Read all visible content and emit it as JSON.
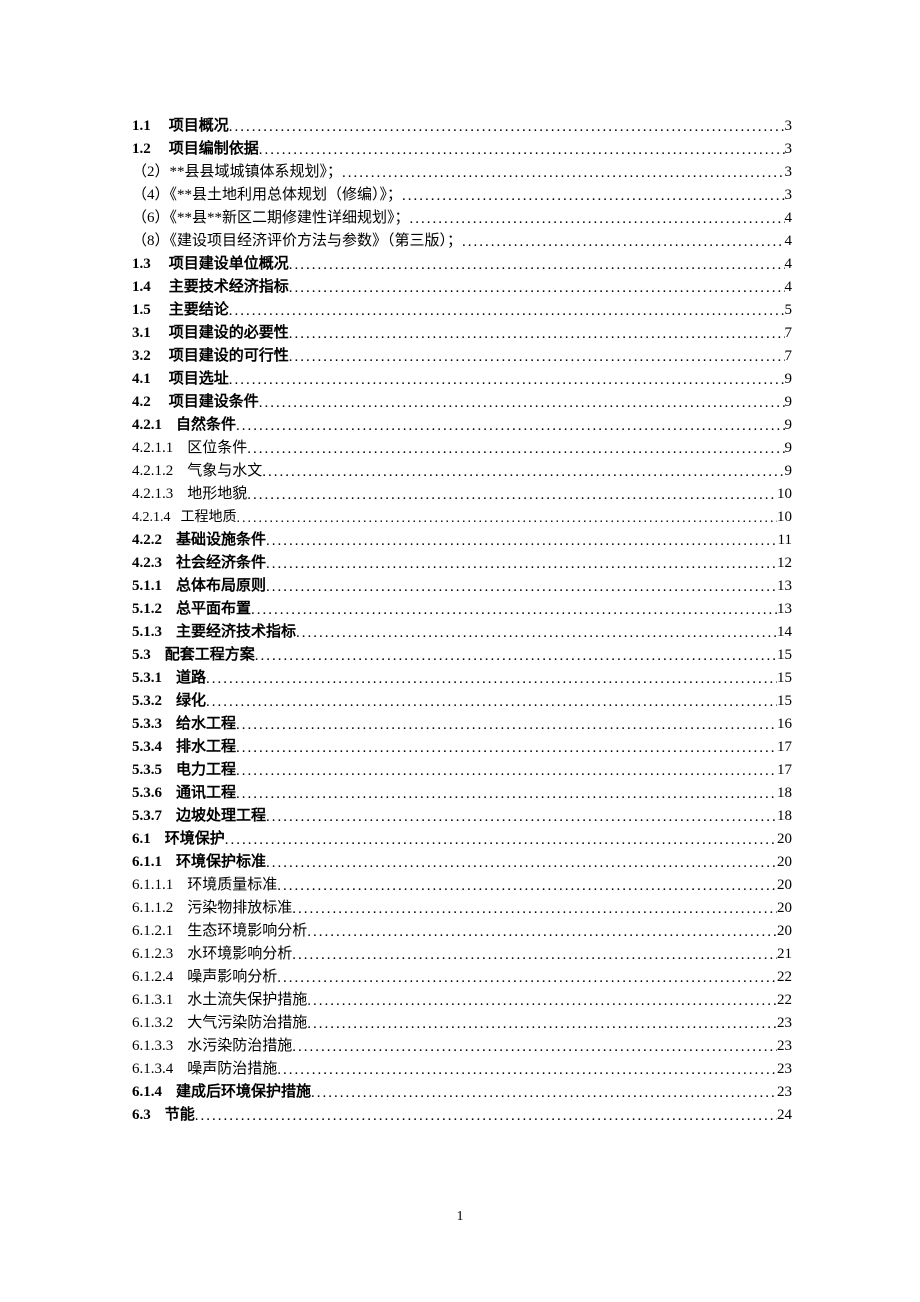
{
  "footer_page": "1",
  "entries": [
    {
      "bold": true,
      "num": "1.1",
      "numGap": "gap-small",
      "title": "项目概况",
      "page": "3"
    },
    {
      "bold": true,
      "num": "1.2",
      "numGap": "gap-small",
      "title": "项目编制依据",
      "page": "3"
    },
    {
      "bold": false,
      "num": "",
      "numGap": "",
      "title": "（2）**县县域城镇体系规划》；",
      "page": "3"
    },
    {
      "bold": false,
      "num": "",
      "numGap": "",
      "title": "（4）《**县土地利用总体规划（修编）》；",
      "page": "3"
    },
    {
      "bold": false,
      "num": "",
      "numGap": "",
      "title": "（6）《**县**新区二期修建性详细规划》；",
      "page": "4"
    },
    {
      "bold": false,
      "num": "",
      "numGap": "",
      "title": "（8）《建设项目经济评价方法与参数》（第三版）；",
      "page": "4"
    },
    {
      "bold": true,
      "num": "1.3",
      "numGap": "gap-small",
      "title": "项目建设单位概况",
      "page": "4"
    },
    {
      "bold": true,
      "num": "1.4",
      "numGap": "gap-small",
      "title": "主要技术经济指标",
      "page": "4"
    },
    {
      "bold": true,
      "num": "1.5",
      "numGap": "gap-small",
      "title": "主要结论",
      "page": "5"
    },
    {
      "bold": true,
      "num": "3.1",
      "numGap": "gap-small",
      "title": "项目建设的必要性",
      "page": "7"
    },
    {
      "bold": true,
      "num": "3.2",
      "numGap": "gap-small",
      "title": "项目建设的可行性",
      "page": "7"
    },
    {
      "bold": true,
      "num": "4.1",
      "numGap": "gap-small",
      "title": "项目选址",
      "page": "9"
    },
    {
      "bold": true,
      "num": "4.2",
      "numGap": "gap-small",
      "title": "项目建设条件",
      "page": "9"
    },
    {
      "bold": true,
      "num": "4.2.1",
      "numGap": "gap-med",
      "title": "自然条件",
      "page": "9"
    },
    {
      "bold": false,
      "num": "4.2.1.1",
      "numGap": "gap-med",
      "title": "区位条件",
      "page": "9"
    },
    {
      "bold": false,
      "num": "4.2.1.2",
      "numGap": "gap-med",
      "title": "气象与水文",
      "page": "9"
    },
    {
      "bold": false,
      "num": "4.2.1.3",
      "numGap": "gap-med",
      "title": "地形地貌",
      "page": "10"
    },
    {
      "bold": false,
      "sans": true,
      "num": "4.2.1.4",
      "numGap": "gap-tight",
      "title": "工程地质",
      "page": "10"
    },
    {
      "bold": true,
      "num": "4.2.2",
      "numGap": "gap-med",
      "title": "基础设施条件",
      "page": "11"
    },
    {
      "bold": true,
      "num": "4.2.3",
      "numGap": "gap-med",
      "title": "社会经济条件",
      "page": "12"
    },
    {
      "bold": true,
      "num": "5.1.1",
      "numGap": "gap-med",
      "title": "总体布局原则",
      "page": "13"
    },
    {
      "bold": true,
      "num": "5.1.2",
      "numGap": "gap-med",
      "title": "总平面布置",
      "page": "13"
    },
    {
      "bold": true,
      "num": "5.1.3",
      "numGap": "gap-med",
      "title": "主要经济技术指标",
      "page": "14"
    },
    {
      "bold": true,
      "num": "5.3",
      "numGap": "gap-med",
      "title": "配套工程方案",
      "page": "15"
    },
    {
      "bold": true,
      "num": "5.3.1",
      "numGap": "gap-med",
      "title": "道路",
      "page": "15"
    },
    {
      "bold": true,
      "num": "5.3.2",
      "numGap": "gap-med",
      "title": "绿化",
      "page": "15"
    },
    {
      "bold": true,
      "num": "5.3.3",
      "numGap": "gap-med",
      "title": "给水工程",
      "page": "16"
    },
    {
      "bold": true,
      "num": "5.3.4",
      "numGap": "gap-med",
      "title": "排水工程",
      "page": "17"
    },
    {
      "bold": true,
      "num": "5.3.5",
      "numGap": "gap-med",
      "title": "电力工程",
      "page": "17"
    },
    {
      "bold": true,
      "num": "5.3.6",
      "numGap": "gap-med",
      "title": "通讯工程",
      "page": "18"
    },
    {
      "bold": true,
      "num": "5.3.7",
      "numGap": "gap-med",
      "title": "边坡处理工程",
      "page": "18"
    },
    {
      "bold": true,
      "num": "6.1",
      "numGap": "gap-med",
      "title": "环境保护",
      "page": "20"
    },
    {
      "bold": true,
      "num": "6.1.1",
      "numGap": "gap-med",
      "title": "环境保护标准",
      "page": "20"
    },
    {
      "bold": false,
      "num": "6.1.1.1",
      "numGap": "gap-med",
      "title": "环境质量标准",
      "page": "20"
    },
    {
      "bold": false,
      "num": "6.1.1.2",
      "numGap": "gap-med",
      "title": "污染物排放标准",
      "page": "20"
    },
    {
      "bold": false,
      "num": "6.1.2.1",
      "numGap": "gap-med",
      "title": "生态环境影响分析",
      "page": "20"
    },
    {
      "bold": false,
      "num": "6.1.2.3",
      "numGap": "gap-med",
      "title": "水环境影响分析",
      "page": "21"
    },
    {
      "bold": false,
      "num": "6.1.2.4",
      "numGap": "gap-med",
      "title": "噪声影响分析",
      "page": "22"
    },
    {
      "bold": false,
      "num": "6.1.3.1",
      "numGap": "gap-med",
      "title": "水土流失保护措施",
      "page": "22"
    },
    {
      "bold": false,
      "num": "6.1.3.2",
      "numGap": "gap-med",
      "title": "大气污染防治措施",
      "page": "23"
    },
    {
      "bold": false,
      "num": "6.1.3.3",
      "numGap": "gap-med",
      "title": "水污染防治措施",
      "page": "23"
    },
    {
      "bold": false,
      "num": "6.1.3.4",
      "numGap": "gap-med",
      "title": "噪声防治措施",
      "page": "23"
    },
    {
      "bold": true,
      "num": "6.1.4",
      "numGap": "gap-med",
      "title": "建成后环境保护措施",
      "page": "23"
    },
    {
      "bold": true,
      "num": "6.3",
      "numGap": "gap-med",
      "title": "节能",
      "page": "24"
    }
  ]
}
